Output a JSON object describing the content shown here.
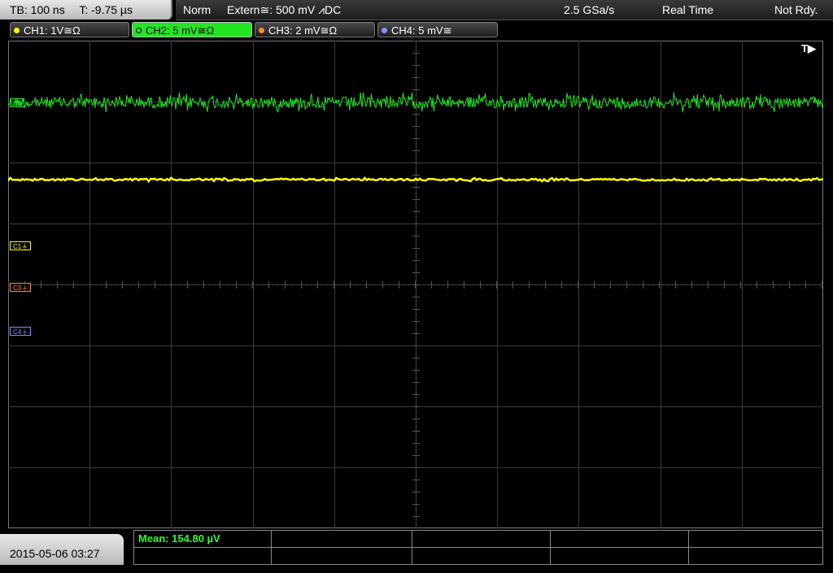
{
  "top": {
    "timebase": "TB: 100 ns",
    "trigger_time": "T: -9.75 µs",
    "mode": "Norm",
    "trigger_source": "Extern≅: 500 mV ⩘DC",
    "sample_rate": "2.5 GSa/s",
    "acq_mode": "Real Time",
    "status": "Not Rdy."
  },
  "channels": [
    {
      "label": "CH1: 1V≅Ω",
      "color": "#ffff00"
    },
    {
      "label": "CH2: 5 mV≅Ω",
      "color": "#22e622"
    },
    {
      "label": "CH3: 2 mV≅Ω",
      "color": "#ff8a2a"
    },
    {
      "label": "CH4: 5 mV≅",
      "color": "#8c8cff"
    }
  ],
  "trigger_marker": "T▶",
  "markers": {
    "c1": "C1⏚",
    "c3": "C3⏚",
    "c4": "C4⏚",
    "c2": "C2"
  },
  "datetime": "2015-05-06 03:27",
  "measurement": {
    "mean": "Mean: 154.80 µV"
  }
}
